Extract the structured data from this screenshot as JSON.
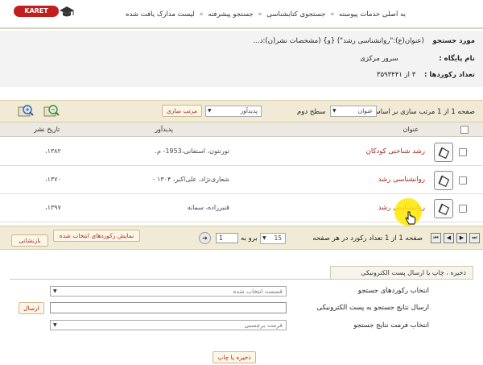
{
  "brand": {
    "logo_text": "KARET",
    "accent": "#c21e1e"
  },
  "breadcrumb": {
    "items": [
      "به اصلی خدمات پیوسته",
      "جستجوی کتابشناسی",
      "جستجو پیشرفته",
      "لیست مدارک یافت شده"
    ],
    "separator": "»"
  },
  "search_info": {
    "query_label": "مورد جستجو",
    "query_value": "(عنوان(ع):\"روانشناسی رشد\") {و} (مشخصات نشر(ن):د...",
    "base_label": "نام پایگاه :",
    "base_value": "سرور مرکزی",
    "count_label": "تعداد رکوردها :",
    "count_value": "۳ از ۳۵۹۳۴۴۱"
  },
  "toolbar": {
    "page_text": "صفحه 1 از 1 مرتب سازی بر اساس",
    "sort1": "عنوان",
    "level2_label": "سطح دوم",
    "sort2": "پدیدآور",
    "sort_button": "مرتب سازی"
  },
  "table": {
    "headers": {
      "title": "عنوان",
      "author": "پدیدآور",
      "date": "تاریخ نشر"
    },
    "rows": [
      {
        "title": "رشد شناختی کودکان",
        "author": "تورنتون، استفانی،1953- م.",
        "date": "،۱۳۸۲"
      },
      {
        "title": "روانشناسی رشد",
        "author": "شعاری‌نژاد، علی‌اکبر، ۱۳۰۴ -",
        "date": "،۱۳۷۰"
      },
      {
        "title": "روانشناسی رشد",
        "author": "قنبرزاده، سمانه",
        "date": "،۱۳۹۷"
      }
    ]
  },
  "pager": {
    "page_text": "صفحه 1 از 1 تعداد رکورد در هر صفحه",
    "per_page": "15",
    "goto_label": "برو به",
    "goto_value": "1",
    "show_selected": "نمایش رکوردهای انتخاب شده",
    "reset": "بازنشانی"
  },
  "save_section": {
    "tab_label": "ذخیره ، چاپ یا ارسال پست الکترونیکی",
    "select_records_label": "انتخاب رکوردهای جستجو",
    "select_records_value": "قسمت انتخاب شده",
    "email_label": "ارسال نتایج جستجو به پست الکترونیکی",
    "send_button": "ارسال",
    "format_label": "انتخاب فرمت نتایج جستجو",
    "format_value": "فرمت برچسبی",
    "save_print_button": "ذخیره یا چاپ"
  }
}
